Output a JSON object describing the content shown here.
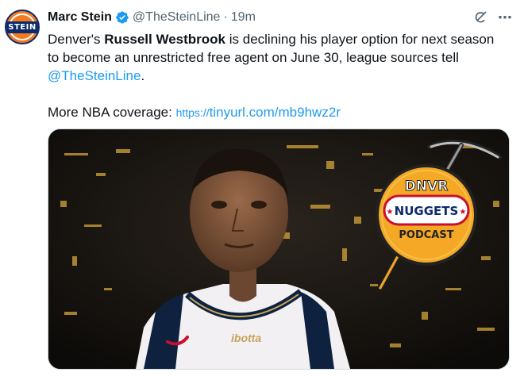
{
  "tweet": {
    "avatar_text": "STEIN",
    "author_name": "Marc Stein",
    "handle": "@TheSteinLine",
    "separator": "·",
    "time": "19m",
    "line1_a": "Denver's ",
    "line1_b": "Russell Westbrook",
    "line1_c": " is declining his player option for next season",
    "line2": "to become an unrestricted free agent on June 30, league sources tell",
    "mention": "@TheSteinLine",
    "period": ".",
    "more_label": "More NBA coverage: ",
    "link_scheme": "https://",
    "link_rest": "tinyurl.com/mb9hwz2r"
  },
  "media": {
    "badge_line1": "DNVR",
    "badge_line2": "NUGGETS",
    "badge_line3": "PODCAST",
    "jersey_text": "ibotta"
  },
  "icons": {
    "verified": "verified-badge-icon",
    "grok": "grok-icon",
    "more": "more-options-icon"
  },
  "colors": {
    "link": "#1d9bf0",
    "secondary": "#536471",
    "badge_orange": "#f4a825",
    "navy": "#0b2a6b"
  }
}
